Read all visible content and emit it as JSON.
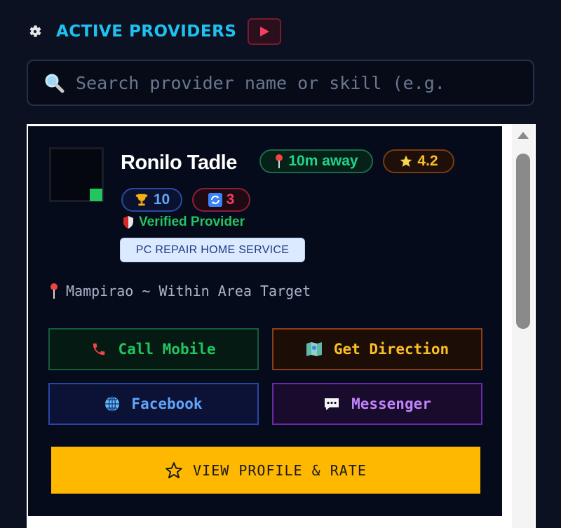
{
  "header": {
    "title": "ACTIVE PROVIDERS",
    "gear_icon": "gear-icon",
    "play_icon": "play-icon"
  },
  "search": {
    "placeholder": "Search provider name or skill (e.g.",
    "value": ""
  },
  "provider": {
    "name": "Ronilo Tadle",
    "distance": "10m away",
    "rating": "4.2",
    "trophies": "10",
    "sync_count": "3",
    "verified_label": "Verified Provider",
    "service_tag": "PC REPAIR HOME SERVICE",
    "location": "Mampirao ~ Within Area Target",
    "status": "online"
  },
  "actions": {
    "call": "Call Mobile",
    "direction": "Get Direction",
    "facebook": "Facebook",
    "messenger": "Messenger",
    "view_profile": "VIEW PROFILE & RATE"
  },
  "colors": {
    "accent_cyan": "#1ec2f0",
    "green": "#22c55e",
    "amber": "#fbbf24",
    "blue": "#60a5fa",
    "purple": "#c084fc",
    "red": "#f43f5e",
    "profile_button": "#ffb800"
  }
}
